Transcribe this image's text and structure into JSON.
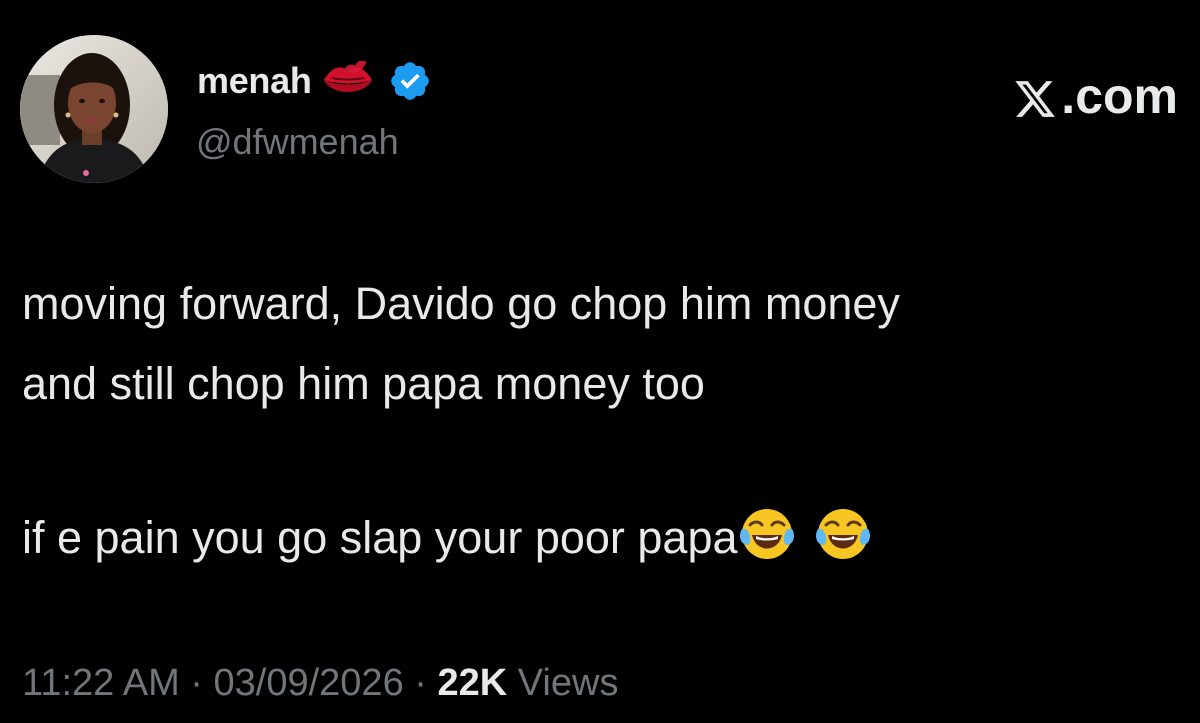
{
  "author": {
    "display_name": "menah",
    "handle": "@dfwmenah",
    "avatar_icon": "avatar-photo",
    "name_emoji": "kiss-mark-icon",
    "verified_icon": "verified-badge-icon",
    "verified_color": "#1d9bf0"
  },
  "brand": {
    "label": ".com",
    "logo_icon": "x-logo-icon"
  },
  "tweet": {
    "line_1": "moving forward, Davido go chop him money",
    "line_2": "and still chop him papa money too",
    "line_3": "if e pain you go slap your poor papa",
    "trailing_emoji": [
      "face-with-tears-of-joy-icon",
      "face-with-tears-of-joy-icon"
    ]
  },
  "meta": {
    "time": "11:22 AM",
    "separator": "·",
    "date": "03/09/2026",
    "views_count": "22K",
    "views_label": "Views"
  },
  "colors": {
    "background": "#000000",
    "text_primary": "#e7e9ea",
    "text_secondary": "#71767b"
  }
}
